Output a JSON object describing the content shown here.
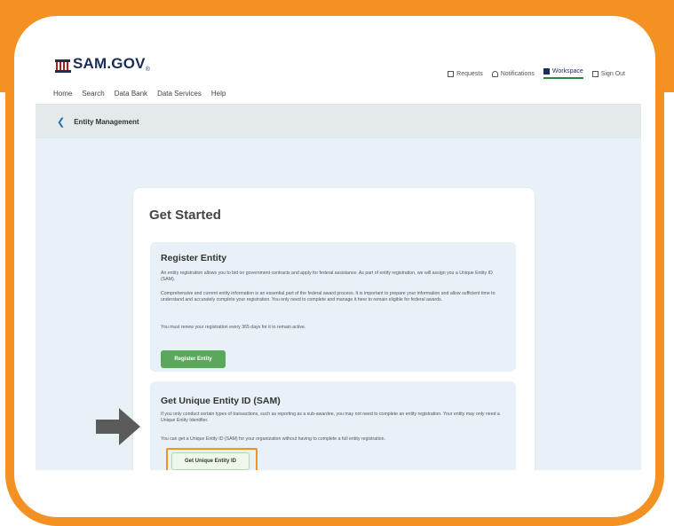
{
  "brand": {
    "name": "SAM.GOV",
    "tm": "®"
  },
  "utility_nav": [
    {
      "label": "Requests",
      "icon": "inbox-icon",
      "active": false
    },
    {
      "label": "Notifications",
      "icon": "bell-icon",
      "active": false
    },
    {
      "label": "Workspace",
      "icon": "grid-icon",
      "active": true
    },
    {
      "label": "Sign Out",
      "icon": "sign-out-icon",
      "active": false
    }
  ],
  "main_nav": [
    "Home",
    "Search",
    "Data Bank",
    "Data Services",
    "Help"
  ],
  "breadcrumb": {
    "back_icon": "chevron-left-icon",
    "title": "Entity Management"
  },
  "panel": {
    "title": "Get Started",
    "register": {
      "heading": "Register Entity",
      "para1": "An entity registration allows you to bid on government contracts and apply for federal assistance. As part of entity registration, we will assign you a Unique Entity ID (SAM).",
      "para2": "Comprehensive and current entity information is an essential part of the federal award process. It is important to prepare your information and allow sufficient time to understand and accurately complete your registration. You only need to complete and manage it here to remain eligible for federal awards.",
      "para3": "You must renew your registration every 365 days for it to remain active.",
      "button": "Register Entity"
    },
    "ueid": {
      "heading": "Get Unique Entity ID (SAM)",
      "para1": "If you only conduct certain types of transactions, such as reporting as a sub-awardee, you may not need to complete an entity registration. Your entity may only need a Unique Entity Identifier.",
      "para2": "You can get a Unique Entity ID (SAM) for your organization without having to complete a full entity registration.",
      "button": "Get Unique Entity ID"
    }
  },
  "colors": {
    "frame": "#f39122",
    "brand_navy": "#1a2e5a",
    "button_green": "#5aa85b",
    "content_bg": "#e8f2f6"
  }
}
